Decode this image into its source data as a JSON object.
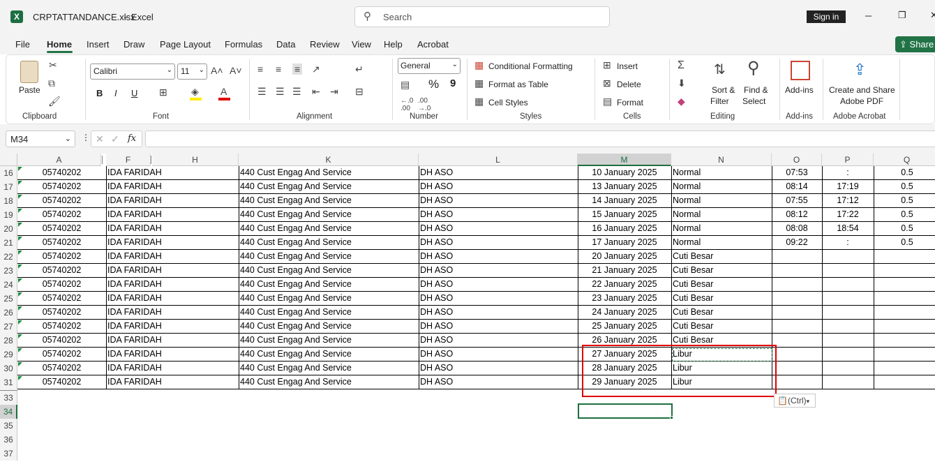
{
  "titlebar": {
    "filename": "CRPTATTANDANCE.xlsx",
    "sep": " - ",
    "app": "Excel",
    "search_placeholder": "Search",
    "signin": "Sign in",
    "min": "─",
    "max": "❐",
    "close": "✕"
  },
  "menu": {
    "tabs": [
      "File",
      "Home",
      "Insert",
      "Draw",
      "Page Layout",
      "Formulas",
      "Data",
      "Review",
      "View",
      "Help",
      "Acrobat"
    ],
    "share": "Share"
  },
  "ribbon": {
    "clipboard": {
      "paste": "Paste",
      "group": "Clipboard"
    },
    "font": {
      "name": "Calibri",
      "size": "11",
      "bold": "B",
      "italic": "I",
      "underline": "U",
      "group": "Font"
    },
    "alignment": {
      "group": "Alignment"
    },
    "number": {
      "format": "General",
      "percent": "%",
      "comma": "9",
      "group": "Number"
    },
    "styles": {
      "cond": "Conditional Formatting",
      "table": "Format as Table",
      "cell": "Cell Styles",
      "group": "Styles"
    },
    "cells": {
      "insert": "Insert",
      "delete": "Delete",
      "format": "Format",
      "group": "Cells"
    },
    "editing": {
      "sort1": "Sort &",
      "sort2": "Filter",
      "find1": "Find &",
      "find2": "Select",
      "group": "Editing"
    },
    "addins": {
      "label": "Add-ins",
      "group": "Add-ins"
    },
    "acrobat": {
      "l1": "Create and Share",
      "l2": "Adobe PDF",
      "group": "Adobe Acrobat"
    }
  },
  "formula": {
    "namebox": "M34",
    "fx": "fx",
    "value": ""
  },
  "columns": [
    "A",
    "F",
    "H",
    "K",
    "L",
    "M",
    "N",
    "O",
    "P",
    "Q"
  ],
  "rows": [
    {
      "n": "16",
      "a": "05740202",
      "f": "IDA FARIDAH",
      "k": "440 Cust Engag And Service",
      "l": "DH ASO",
      "m": "10 January 2025",
      "nn": "Normal",
      "o": "07:53",
      "p": ":",
      "q": "0.5"
    },
    {
      "n": "17",
      "a": "05740202",
      "f": "IDA FARIDAH",
      "k": "440 Cust Engag And Service",
      "l": "DH ASO",
      "m": "13 January 2025",
      "nn": "Normal",
      "o": "08:14",
      "p": "17:19",
      "q": "0.5"
    },
    {
      "n": "18",
      "a": "05740202",
      "f": "IDA FARIDAH",
      "k": "440 Cust Engag And Service",
      "l": "DH ASO",
      "m": "14 January 2025",
      "nn": "Normal",
      "o": "07:55",
      "p": "17:12",
      "q": "0.5"
    },
    {
      "n": "19",
      "a": "05740202",
      "f": "IDA FARIDAH",
      "k": "440 Cust Engag And Service",
      "l": "DH ASO",
      "m": "15 January 2025",
      "nn": "Normal",
      "o": "08:12",
      "p": "17:22",
      "q": "0.5"
    },
    {
      "n": "20",
      "a": "05740202",
      "f": "IDA FARIDAH",
      "k": "440 Cust Engag And Service",
      "l": "DH ASO",
      "m": "16 January 2025",
      "nn": "Normal",
      "o": "08:08",
      "p": "18:54",
      "q": "0.5"
    },
    {
      "n": "21",
      "a": "05740202",
      "f": "IDA FARIDAH",
      "k": "440 Cust Engag And Service",
      "l": "DH ASO",
      "m": "17 January 2025",
      "nn": "Normal",
      "o": "09:22",
      "p": ":",
      "q": "0.5"
    },
    {
      "n": "22",
      "a": "05740202",
      "f": "IDA FARIDAH",
      "k": "440 Cust Engag And Service",
      "l": "DH ASO",
      "m": "20 January 2025",
      "nn": "Cuti Besar",
      "o": "",
      "p": "",
      "q": ""
    },
    {
      "n": "23",
      "a": "05740202",
      "f": "IDA FARIDAH",
      "k": "440 Cust Engag And Service",
      "l": "DH ASO",
      "m": "21 January 2025",
      "nn": "Cuti Besar",
      "o": "",
      "p": "",
      "q": ""
    },
    {
      "n": "24",
      "a": "05740202",
      "f": "IDA FARIDAH",
      "k": "440 Cust Engag And Service",
      "l": "DH ASO",
      "m": "22 January 2025",
      "nn": "Cuti Besar",
      "o": "",
      "p": "",
      "q": ""
    },
    {
      "n": "25",
      "a": "05740202",
      "f": "IDA FARIDAH",
      "k": "440 Cust Engag And Service",
      "l": "DH ASO",
      "m": "23 January 2025",
      "nn": "Cuti Besar",
      "o": "",
      "p": "",
      "q": ""
    },
    {
      "n": "26",
      "a": "05740202",
      "f": "IDA FARIDAH",
      "k": "440 Cust Engag And Service",
      "l": "DH ASO",
      "m": "24 January 2025",
      "nn": "Cuti Besar",
      "o": "",
      "p": "",
      "q": ""
    },
    {
      "n": "27",
      "a": "05740202",
      "f": "IDA FARIDAH",
      "k": "440 Cust Engag And Service",
      "l": "DH ASO",
      "m": "25 January 2025",
      "nn": "Cuti Besar",
      "o": "",
      "p": "",
      "q": ""
    },
    {
      "n": "28",
      "a": "05740202",
      "f": "IDA FARIDAH",
      "k": "440 Cust Engag And Service",
      "l": "DH ASO",
      "m": "26 January 2025",
      "nn": "Cuti Besar",
      "o": "",
      "p": "",
      "q": ""
    },
    {
      "n": "29",
      "a": "05740202",
      "f": "IDA FARIDAH",
      "k": "440 Cust Engag And Service",
      "l": "DH ASO",
      "m": "27 January 2025",
      "nn": "Libur",
      "o": "",
      "p": "",
      "q": ""
    },
    {
      "n": "30",
      "a": "05740202",
      "f": "IDA FARIDAH",
      "k": "440 Cust Engag And Service",
      "l": "DH ASO",
      "m": "28 January 2025",
      "nn": "Libur",
      "o": "",
      "p": "",
      "q": ""
    },
    {
      "n": "31",
      "a": "05740202",
      "f": "IDA FARIDAH",
      "k": "440 Cust Engag And Service",
      "l": "DH ASO",
      "m": "29 January 2025",
      "nn": "Libur",
      "o": "",
      "p": "",
      "q": ""
    }
  ],
  "empty_rows": [
    "33",
    "34",
    "35",
    "36",
    "37"
  ],
  "paste_options": "(Ctrl)",
  "colors": {
    "accent": "#217346",
    "highlight": "#e00000"
  }
}
